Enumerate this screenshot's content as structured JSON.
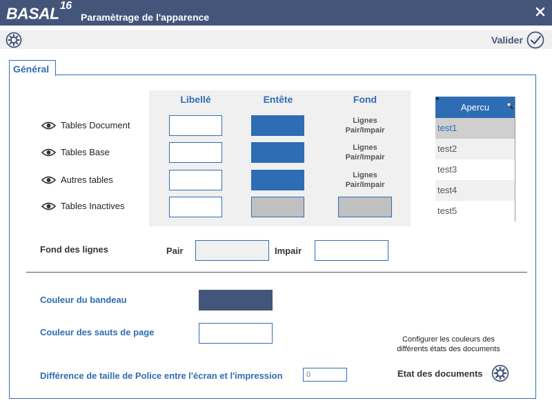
{
  "app": {
    "logo_text": "BASAL",
    "logo_version": "16",
    "title": "Paramètrage de l'apparence"
  },
  "toolbar": {
    "validate_label": "Valider"
  },
  "tabs": [
    {
      "label": "Général"
    }
  ],
  "grid": {
    "headers": {
      "libelle": "Libellé",
      "entete": "Entête",
      "fond": "Fond"
    },
    "rows": [
      {
        "label": "Tables Document",
        "libelle_color": "#ffffff",
        "entete_color": "#2e6db4",
        "fond_line1": "Lignes",
        "fond_line2": "Pair/Impair"
      },
      {
        "label": "Tables Base",
        "libelle_color": "#ffffff",
        "entete_color": "#2e6db4",
        "fond_line1": "Lignes",
        "fond_line2": "Pair/Impair"
      },
      {
        "label": "Autres tables",
        "libelle_color": "#ffffff",
        "entete_color": "#2e6db4",
        "fond_line1": "Lignes",
        "fond_line2": "Pair/Impair"
      },
      {
        "label": "Tables Inactives",
        "libelle_color": "#ffffff",
        "entete_color": "#c0c0c0",
        "fond_color": "#c0c0c0"
      }
    ]
  },
  "preview": {
    "header": "Apercu",
    "rows": [
      "test1",
      "test2",
      "test3",
      "test4",
      "test5"
    ],
    "selected_index": 0
  },
  "fond_lignes": {
    "label": "Fond des lignes",
    "pair_label": "Pair",
    "impair_label": "Impair",
    "pair_color": "#f0f0f0",
    "impair_color": "#ffffff"
  },
  "bandeau": {
    "label": "Couleur du bandeau",
    "color": "#44557a"
  },
  "sauts_page": {
    "label": "Couleur des sauts de page",
    "color": "#ffffff"
  },
  "font_diff": {
    "label": "Différence de taille de Police entre l'écran et l'impression",
    "value": "0"
  },
  "etat": {
    "description_line1": "Configurer les couleurs des",
    "description_line2": "différents états des documents",
    "button_label": "Etat des documents"
  },
  "colors": {
    "titlebar": "#44557a",
    "accent": "#2e6db4",
    "toolbar_bg": "#f0f0f0",
    "grid_bg": "#f0f0f0"
  }
}
